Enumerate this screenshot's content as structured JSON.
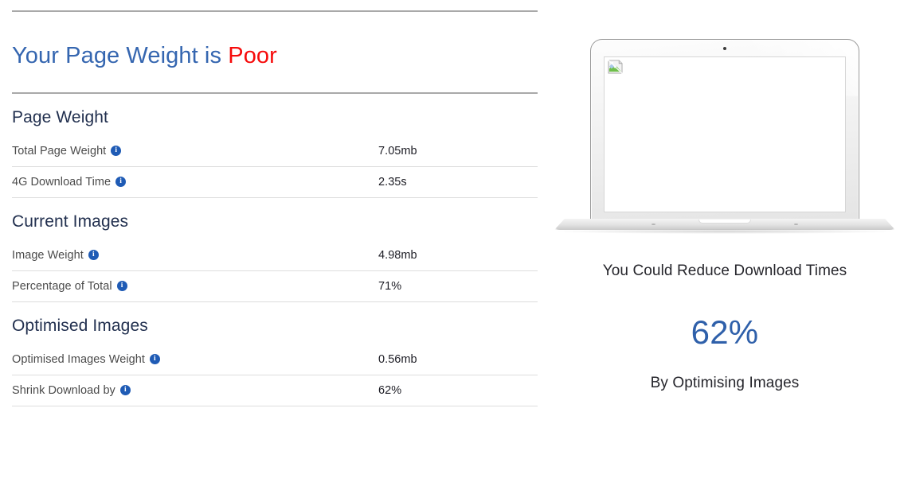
{
  "headline": {
    "prefix": "Your Page Weight is",
    "verdict": "Poor"
  },
  "sections": [
    {
      "title": "Page Weight",
      "rows": [
        {
          "label": "Total Page Weight",
          "info": "i",
          "value": "7.05mb"
        },
        {
          "label": "4G Download Time",
          "info": "i",
          "value": "2.35s"
        }
      ]
    },
    {
      "title": "Current Images",
      "rows": [
        {
          "label": "Image Weight",
          "info": "i",
          "value": "4.98mb"
        },
        {
          "label": "Percentage of Total",
          "info": "i",
          "value": "71%"
        }
      ]
    },
    {
      "title": "Optimised Images",
      "rows": [
        {
          "label": "Optimised Images Weight",
          "info": "i",
          "value": "0.56mb"
        },
        {
          "label": "Shrink Download by",
          "info": "i",
          "value": "62%"
        }
      ]
    }
  ],
  "preview": {
    "device": "laptop-mockup",
    "screen_content": "broken-image-placeholder",
    "caption_top": "You Could Reduce Download Times",
    "percent": "62%",
    "caption_bottom": "By Optimising Images"
  },
  "colors": {
    "headline_blue": "#3566b0",
    "verdict_red": "#f60b0b",
    "accent_blue": "#2f60aa",
    "info_icon_blue": "#1f5bb5",
    "section_heading": "#22304f",
    "label_gray": "#4b4b4b",
    "value_dark": "#1c1c24",
    "rule_gray": "#a9a9a9",
    "row_divider": "#dddddd"
  }
}
